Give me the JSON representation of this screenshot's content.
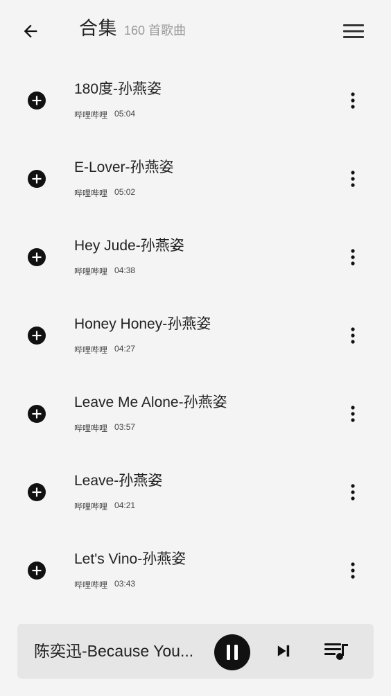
{
  "header": {
    "title": "合集",
    "count_text": "160 首歌曲",
    "icons": {
      "back": "arrow-left-icon",
      "menu": "menu-icon"
    }
  },
  "songs": [
    {
      "title": "180度-孙燕姿",
      "source": "哔哩哔哩",
      "duration": "05:04"
    },
    {
      "title": "E-Lover-孙燕姿",
      "source": "哔哩哔哩",
      "duration": "05:02"
    },
    {
      "title": "Hey Jude-孙燕姿",
      "source": "哔哩哔哩",
      "duration": "04:38"
    },
    {
      "title": "Honey Honey-孙燕姿",
      "source": "哔哩哔哩",
      "duration": "04:27"
    },
    {
      "title": "Leave Me Alone-孙燕姿",
      "source": "哔哩哔哩",
      "duration": "03:57"
    },
    {
      "title": "Leave-孙燕姿",
      "source": "哔哩哔哩",
      "duration": "04:21"
    },
    {
      "title": "Let's Vino-孙燕姿",
      "source": "哔哩哔哩",
      "duration": "03:43"
    }
  ],
  "player": {
    "now_playing": "陈奕迅-Because You...",
    "icons": {
      "pause": "pause-icon",
      "next": "skip-next-icon",
      "queue": "playlist-icon"
    }
  },
  "colors": {
    "background": "#f4f4f4",
    "player_background": "#e6e6e6",
    "text_primary": "#222222",
    "text_secondary": "#999999",
    "icon": "#111111"
  }
}
